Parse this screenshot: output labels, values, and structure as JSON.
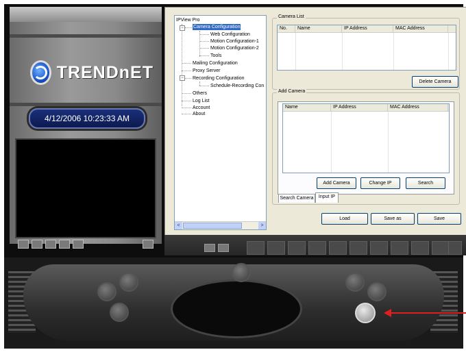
{
  "brand": {
    "logo_text": "TRENDnET"
  },
  "clock": {
    "datetime": "4/12/2006 10:23:33 AM"
  },
  "tree": {
    "root": "IPView Pro",
    "items": [
      {
        "label": "Camera Configuration",
        "selected": true
      },
      {
        "label": "Web Configuration"
      },
      {
        "label": "Motion Configuration-1"
      },
      {
        "label": "Motion Configuration-2"
      },
      {
        "label": "Tools"
      },
      {
        "label": "Mailing Configuration"
      },
      {
        "label": "Proxy Server"
      },
      {
        "label": "Recording Configuration"
      },
      {
        "label": "Schedule-Recording Con"
      },
      {
        "label": "Others"
      },
      {
        "label": "Log List"
      },
      {
        "label": "Account"
      },
      {
        "label": "About"
      }
    ],
    "scroll_left": "<",
    "scroll_right": ">"
  },
  "camera_list": {
    "title": "Camera List",
    "columns": [
      "No.",
      "Name",
      "IP Address",
      "MAC Address"
    ],
    "delete_label": "Delete Camera"
  },
  "add_camera": {
    "title": "Add Camera",
    "columns": [
      "Name",
      "IP Address",
      "MAC Address"
    ],
    "buttons": {
      "add": "Add Camera",
      "change_ip": "Change IP",
      "search": "Search"
    },
    "tabs": [
      "Search Camera",
      "Input IP"
    ],
    "active_tab": "Input IP"
  },
  "footer_buttons": {
    "load": "Load",
    "save_as": "Save as",
    "save": "Save"
  },
  "colors": {
    "accent": "#316ac5",
    "arrow": "#e02020",
    "clock_bg": "#1a2f7a"
  }
}
